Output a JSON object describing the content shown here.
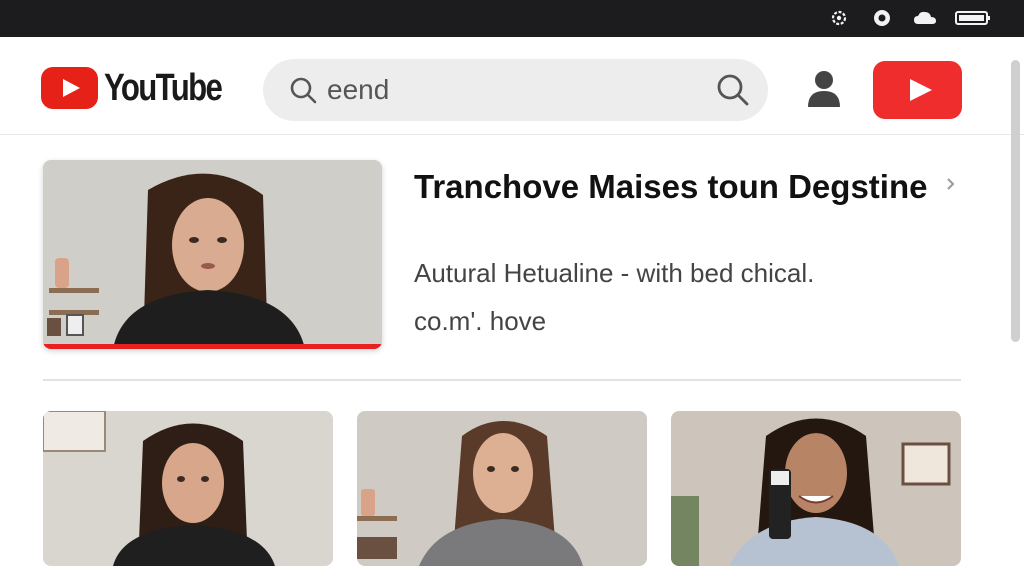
{
  "colors": {
    "brand_red": "#e62117",
    "create_button": "#ef2d2d",
    "system_bar": "#1c1c1e",
    "search_bg": "#ededed"
  },
  "system_bar": {
    "icons": [
      "settings-gear-icon",
      "record-icon",
      "cloud-icon",
      "battery-icon"
    ]
  },
  "header": {
    "logo_text": "YouTube",
    "search": {
      "value": "eend",
      "icon": "search-icon"
    },
    "account_icon": "person-icon",
    "create_icon": "play-icon"
  },
  "featured": {
    "title": "Tranchove Maises toun Degstine",
    "description": "Autural Hetualine - with bed chical.",
    "meta": "co.m'. hove",
    "watch_progress": 1.0,
    "more_icon": "chevron-right-icon"
  },
  "grid": [
    {
      "title": ""
    },
    {
      "title": ""
    },
    {
      "title": ""
    }
  ]
}
